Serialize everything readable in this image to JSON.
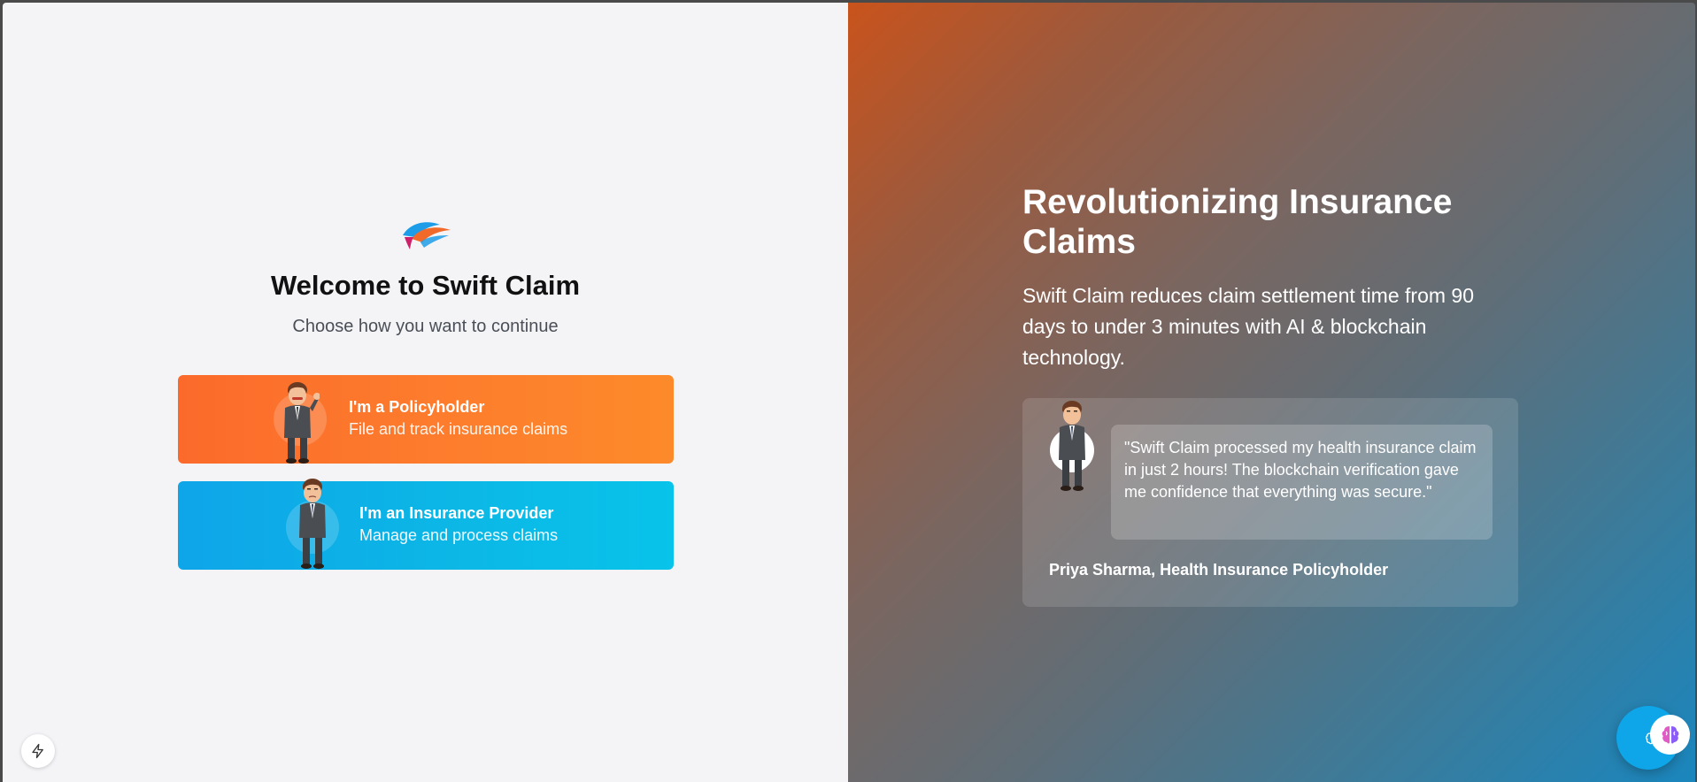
{
  "welcome": {
    "title": "Welcome to Swift Claim",
    "subtitle": "Choose how you want to continue"
  },
  "roles": [
    {
      "title": "I'm a Policyholder",
      "subtitle": "File and track insurance claims",
      "color": "#fb6a2b",
      "avatar": "waving-man-avatar-icon"
    },
    {
      "title": "I'm an Insurance Provider",
      "subtitle": "Manage and process claims",
      "color": "#0ea5e9",
      "avatar": "standing-man-avatar-icon"
    }
  ],
  "promo": {
    "title": "Revolutionizing Insurance Claims",
    "description": "Swift Claim reduces claim settlement time from 90 days to under 3 minutes with AI & blockchain technology.",
    "testimonial": {
      "quote": "\"Swift Claim processed my health insurance claim in just 2 hours! The blockchain verification gave me confidence that everything was secure.\"",
      "author": "Priya Sharma, Health Insurance Policyholder"
    }
  },
  "colors": {
    "accent_orange": "#fb6a2b",
    "accent_blue": "#0ea5e9",
    "gradient_start": "#c9531c",
    "gradient_end": "#1a86bd"
  },
  "icons": {
    "logo": "swift-claim-logo-icon",
    "bolt": "bolt-icon",
    "assistant": "brain-icon"
  }
}
